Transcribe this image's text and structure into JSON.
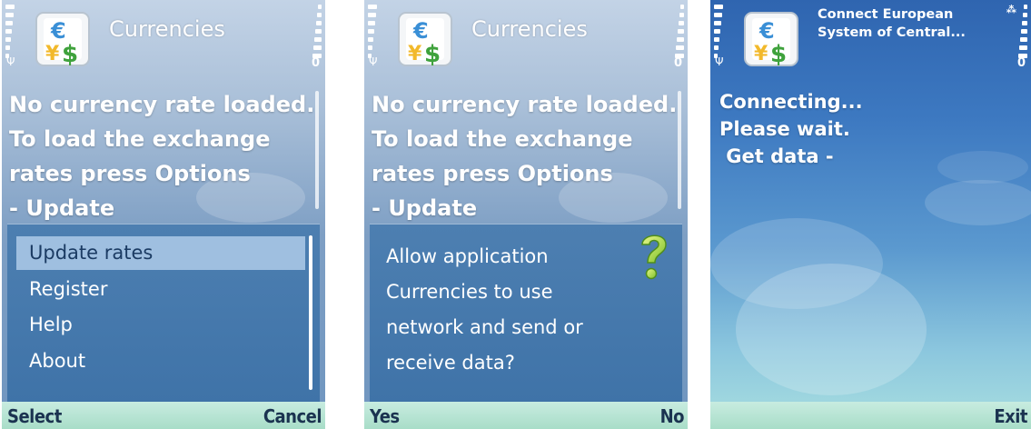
{
  "screens": [
    {
      "title": "Currencies",
      "message_lines": [
        "No currency rate loaded.",
        "To load the exchange",
        "rates press Options",
        "- Update"
      ],
      "menu": {
        "items": [
          {
            "label": "Update rates",
            "selected": true
          },
          {
            "label": "Register",
            "selected": false
          },
          {
            "label": "Help",
            "selected": false
          },
          {
            "label": "About",
            "selected": false
          }
        ]
      },
      "softkeys": {
        "left": "Select",
        "right": "Cancel"
      },
      "battery_indicator": "0"
    },
    {
      "title": "Currencies",
      "message_lines": [
        "No currency rate loaded.",
        "To load the exchange",
        "rates press Options",
        "- Update"
      ],
      "query": {
        "lines": [
          "Allow application",
          "Currencies to use",
          "network and send or",
          "receive data?"
        ],
        "icon": "question-icon"
      },
      "softkeys": {
        "left": "Yes",
        "right": "No"
      },
      "battery_indicator": "0"
    },
    {
      "title_lines": [
        "Connect European",
        "System of Central..."
      ],
      "message_lines": [
        "Connecting...",
        "Please wait.",
        " Get data -"
      ],
      "softkeys": {
        "left": "",
        "right": "Exit"
      },
      "battery_indicator": "0",
      "corner_glyph": "⁂"
    }
  ],
  "colors": {
    "popup_bg": "#4479ad",
    "menu_highlight": "#9fbfe0",
    "softkey_bar": "#b8e4d4",
    "softkey_text": "#1b3350"
  },
  "icons": {
    "app": "currency-converter-icon",
    "signal": "signal-strength-icon",
    "battery": "battery-level-icon",
    "antenna": "antenna-icon"
  }
}
